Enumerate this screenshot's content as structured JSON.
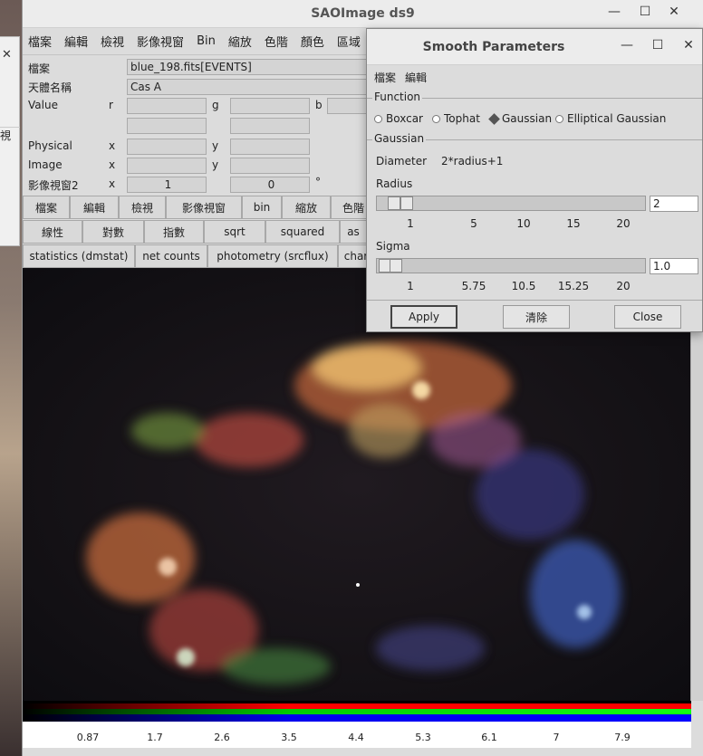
{
  "main": {
    "title": "SAOImage ds9",
    "menu": [
      "檔案",
      "編輯",
      "檢視",
      "影像視窗",
      "Bin",
      "縮放",
      "色階",
      "顏色",
      "區域"
    ],
    "info": {
      "file_label": "檔案",
      "file_value": "blue_198.fits[EVENTS]",
      "object_label": "天體名稱",
      "object_value": "Cas A",
      "value_label": "Value",
      "r": "r",
      "g": "g",
      "b": "b",
      "physical_label": "Physical",
      "image_label": "Image",
      "frame_label": "影像視窗2",
      "x": "x",
      "y": "y",
      "frame_val1": "1",
      "frame_val2": "0",
      "degree": "°"
    },
    "buttons_row1": [
      "檔案",
      "編輯",
      "檢視",
      "影像視窗",
      "bin",
      "縮放",
      "色階"
    ],
    "buttons_row2": [
      "線性",
      "對數",
      "指數",
      "sqrt",
      "squared",
      "as"
    ],
    "buttons_row3": [
      "statistics (dmstat)",
      "net counts",
      "photometry (srcflux)",
      "char"
    ],
    "colorbar_ticks": [
      "0.87",
      "1.7",
      "2.6",
      "3.5",
      "4.4",
      "5.3",
      "6.1",
      "7",
      "7.9"
    ]
  },
  "sliver": {
    "label": "視"
  },
  "dialog": {
    "title": "Smooth Parameters",
    "menu": [
      "檔案",
      "編輯"
    ],
    "function_label": "Function",
    "functions": [
      "Boxcar",
      "Tophat",
      "Gaussian",
      "Elliptical Gaussian"
    ],
    "selected_function": "Gaussian",
    "gaussian_label": "Gaussian",
    "diameter_label": "Diameter",
    "diameter_value": "2*radius+1",
    "radius_label": "Radius",
    "radius_value": "2",
    "radius_ticks": [
      "1",
      "5",
      "10",
      "15",
      "20"
    ],
    "sigma_label": "Sigma",
    "sigma_value": "1.0",
    "sigma_ticks": [
      "1",
      "5.75",
      "10.5",
      "15.25",
      "20"
    ],
    "apply": "Apply",
    "clear": "清除",
    "close": "Close"
  },
  "colors": {
    "accent": "#555555"
  }
}
